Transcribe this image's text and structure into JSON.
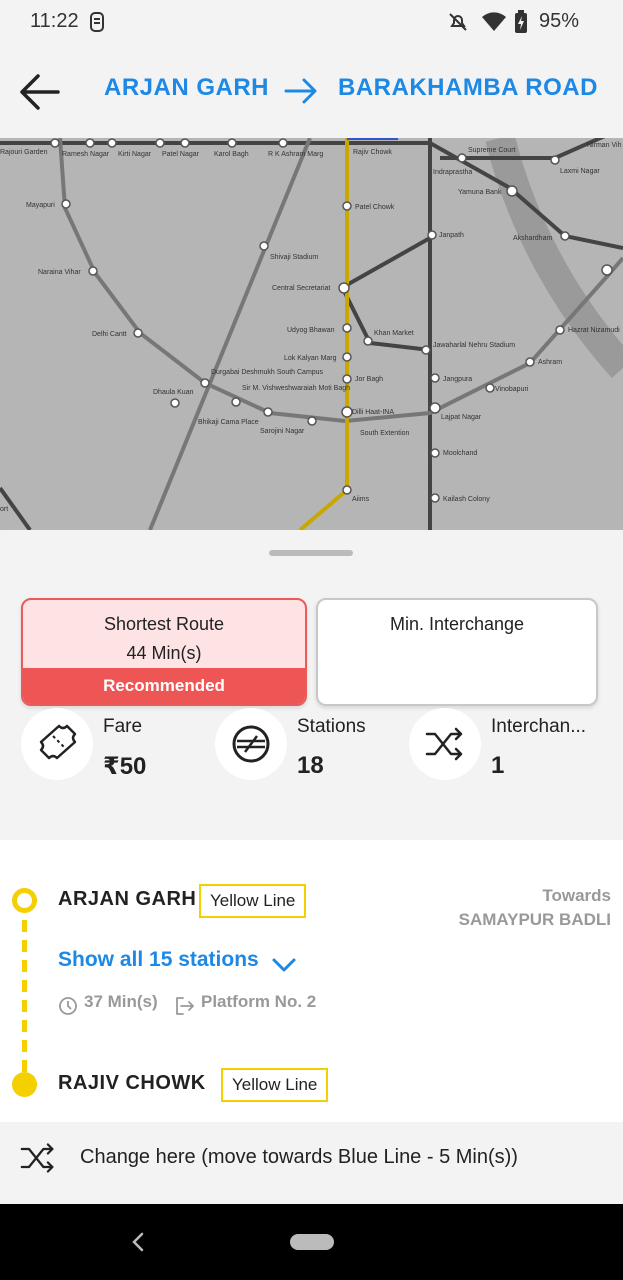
{
  "status": {
    "time": "11:22",
    "battery": "95%"
  },
  "header": {
    "from": "ARJAN GARH",
    "to": "BARAKHAMBA ROAD"
  },
  "map": {
    "stations": [
      "Rajouri Garden",
      "Ramesh Nagar",
      "Kirti Nagar",
      "Patel Nagar",
      "Karol Bagh",
      "R K Ashram Marg",
      "Rajiv Chowk",
      "Supreme Court",
      "Nirman Vih",
      "Indraprastha",
      "Laxmi Nagar",
      "Yamuna Bank",
      "Mayapuri",
      "Patel Chowk",
      "Janpath",
      "Akshardham",
      "Naraina Vihar",
      "Shivaji Stadium",
      "Central Secretariat",
      "Delhi Cantt",
      "Udyog Bhawan",
      "Khan Market",
      "Jawaharlal Nehru Stadium",
      "Hazrat Nizamudi",
      "Lok Kalyan Marg",
      "Ashram",
      "Durgabai Deshmukh South Campus",
      "Dhaula Kuan",
      "Jor Bagh",
      "Jangpura",
      "Vinobapuri",
      "Sir M. Vishweshwaraiah Moti Bagh",
      "Dilli Haat-INA",
      "Lajpat Nagar",
      "Bhikaji Cama Place",
      "Sarojini Nagar",
      "South Extention",
      "Moolchand",
      "Aiims",
      "Kailash Colony",
      "ort"
    ]
  },
  "options": {
    "shortest": {
      "title": "Shortest Route",
      "time": "44 Min(s)",
      "badge": "Recommended"
    },
    "min_interchange": {
      "title": "Min. Interchange"
    }
  },
  "stats": {
    "fare": {
      "label": "Fare",
      "value": "₹50"
    },
    "stations": {
      "label": "Stations",
      "value": "18"
    },
    "interchanges": {
      "label": "Interchan...",
      "value": "1"
    }
  },
  "journey": {
    "start_station": "ARJAN GARH",
    "start_line": "Yellow Line",
    "towards_label": "Towards",
    "towards_dest": "SAMAYPUR BADLI",
    "show_all": "Show all 15 stations",
    "duration": "37 Min(s)",
    "platform": "Platform No. 2",
    "end_station": "RAJIV CHOWK",
    "end_line": "Yellow Line"
  },
  "change": {
    "text": "Change here (move towards Blue Line - 5 Min(s))"
  },
  "colors": {
    "accent": "#1e88e5",
    "yellow_line": "#f5d000",
    "recommended": "#ee5656"
  }
}
